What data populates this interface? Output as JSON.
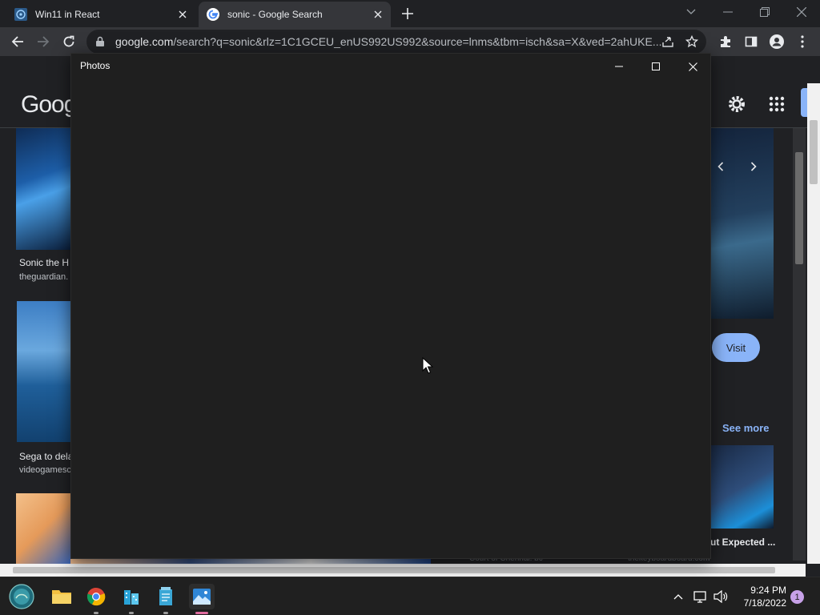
{
  "browser": {
    "tabs": [
      {
        "title": "Win11 in React",
        "icon": "react-app-favicon"
      },
      {
        "title": "sonic - Google Search",
        "icon": "google-favicon",
        "active": true
      }
    ],
    "url_host": "google.com",
    "url_rest": "/search?q=sonic&rlz=1C1GCEU_enUS992US992&source=lnms&tbm=isch&sa=X&ved=2ahUKE..."
  },
  "google_page": {
    "logo_text": "Goog",
    "results": [
      {
        "title": "Sonic the H",
        "source": "theguardian."
      },
      {
        "title": "Sega to dela",
        "source": "videogamesc"
      }
    ],
    "visit_label": "Visit",
    "see_more_label": "See more",
    "right_result_title": "ut Expected ...",
    "bottom_sources": [
      "Court of Chennai. bc",
      "thekeyboardboard.com"
    ]
  },
  "photos_window": {
    "title": "Photos"
  },
  "taskbar": {
    "time": "9:24 PM",
    "date": "7/18/2022",
    "notification_count": "1",
    "apps": [
      "start-icon",
      "file-explorer-icon",
      "chrome-icon",
      "buildings-icon",
      "notepad-icon",
      "photos-icon"
    ]
  },
  "colors": {
    "accent_blue": "#8ab4f8",
    "photos_bg": "#1f1f1f",
    "taskbar_bg": "#202020"
  }
}
